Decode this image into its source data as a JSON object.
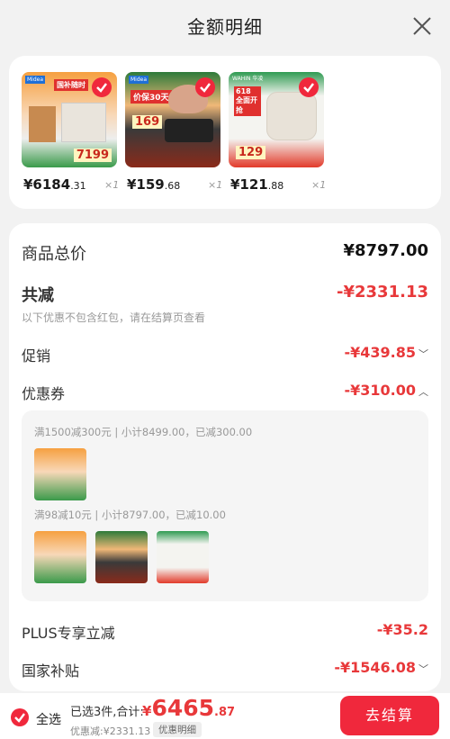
{
  "header": {
    "title": "金额明细"
  },
  "products": [
    {
      "price_int": "¥6184",
      "price_dec": ".31",
      "qty": "×1",
      "badge": "国补随时",
      "brand": "Midea",
      "price_tag": "7199"
    },
    {
      "price_int": "¥159",
      "price_dec": ".68",
      "qty": "×1",
      "badge": "价保30天",
      "brand": "Midea",
      "price_tag": "169"
    },
    {
      "price_int": "¥121",
      "price_dec": ".88",
      "qty": "×1",
      "badge": "618 全面开抢",
      "brand": "WAHIN 华凌",
      "price_tag": "129"
    }
  ],
  "summary": {
    "total_label": "商品总价",
    "total_value": "¥8797.00",
    "discount_label": "共减",
    "discount_value": "-¥2331.13",
    "note": "以下优惠不包含红包，请在结算页查看",
    "promo_label": "促销",
    "promo_value": "-¥439.85",
    "coupon_label": "优惠券",
    "coupon_value": "-¥310.00",
    "coupon_line1": "满1500减300元 | 小计8499.00，已减300.00",
    "coupon_line2": "满98减10元 | 小计8797.00，已减10.00",
    "plus_label": "PLUS专享立减",
    "plus_value": "-¥35.2",
    "subsidy_label": "国家补贴",
    "subsidy_value": "-¥1546.08"
  },
  "bottom": {
    "select_all": "全选",
    "selected_text": "已选3件,合计:",
    "total_int": "6465",
    "total_dec": ".87",
    "currency": "¥",
    "discount_text": "优惠减:¥2331.13",
    "detail_tag": "优惠明细",
    "checkout": "去结算"
  },
  "colors": {
    "accent": "#f0283c",
    "price_red": "#e8383a"
  }
}
